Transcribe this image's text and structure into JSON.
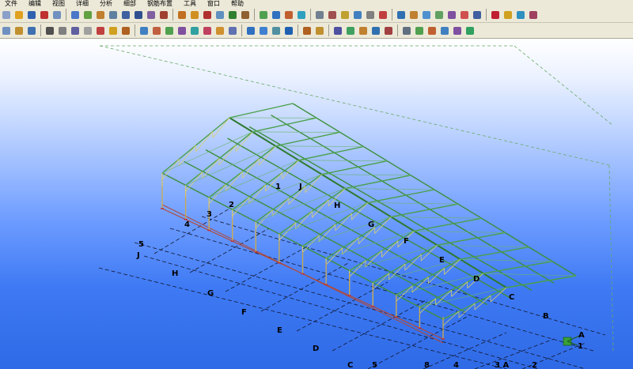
{
  "menu": {
    "items": [
      "文件",
      "编辑",
      "视图",
      "详细",
      "分析",
      "细部",
      "钢筋布置",
      "工具",
      "窗口",
      "帮助"
    ]
  },
  "toolbar1": {
    "groups": [
      [
        "#8aa0c8",
        "#e0a020",
        "#3060b0",
        "#c03030",
        "#7090c0"
      ],
      [
        "#4a78c8",
        "#60a040",
        "#c08030",
        "#6080a0",
        "#4060a0",
        "#305090",
        "#8060a0",
        "#a04030"
      ],
      [
        "#c07020",
        "#d09020",
        "#b03030",
        "#6090c0",
        "#308030",
        "#906030"
      ],
      [
        "#50a050",
        "#3070c0",
        "#c06030",
        "#30a0c0"
      ],
      [
        "#708090",
        "#a05050",
        "#c0a030",
        "#4080c0",
        "#808080",
        "#c04040"
      ],
      [
        "#3070b0",
        "#c08030",
        "#5090d0",
        "#60a060",
        "#8050a0",
        "#d05050",
        "#4060a0"
      ],
      [
        "#c02030",
        "#d0a020",
        "#3090c0",
        "#a04060"
      ]
    ]
  },
  "toolbar2": {
    "groups": [
      [
        "#7090c0",
        "#c09030",
        "#4070b0"
      ],
      [
        "#505050",
        "#808080",
        "#6060a0",
        "#a0a0a0",
        "#c04040",
        "#d0a020",
        "#b06020"
      ],
      [
        "#4080c0",
        "#c06040",
        "#50a050",
        "#8050a0",
        "#30a0a0",
        "#c04060",
        "#d09030",
        "#6070b0"
      ],
      [
        "#3070c0",
        "#4080d0",
        "#5090a0",
        "#2060b0"
      ],
      [
        "#b06020",
        "#c09030"
      ],
      [
        "#5050a0",
        "#40a060",
        "#c08030",
        "#3070b0",
        "#a04040"
      ],
      [
        "#607080",
        "#50a050",
        "#c06030",
        "#4080c0",
        "#8050a0",
        "#30a060"
      ]
    ]
  },
  "model": {
    "grid_labels_front": [
      "C",
      "5",
      "8",
      "4",
      "3 A",
      "2"
    ],
    "grid_labels_left": [
      "5",
      "J",
      "H",
      "G",
      "F",
      "E",
      "D"
    ],
    "grid_labels_back": [
      "4",
      "3",
      "2"
    ],
    "grid_labels_top": [
      "1",
      "J"
    ],
    "grid_labels_center": [
      "H",
      "G",
      "F",
      "E",
      "D",
      "C",
      "B"
    ],
    "axis_labels": [
      "A",
      "1"
    ]
  }
}
